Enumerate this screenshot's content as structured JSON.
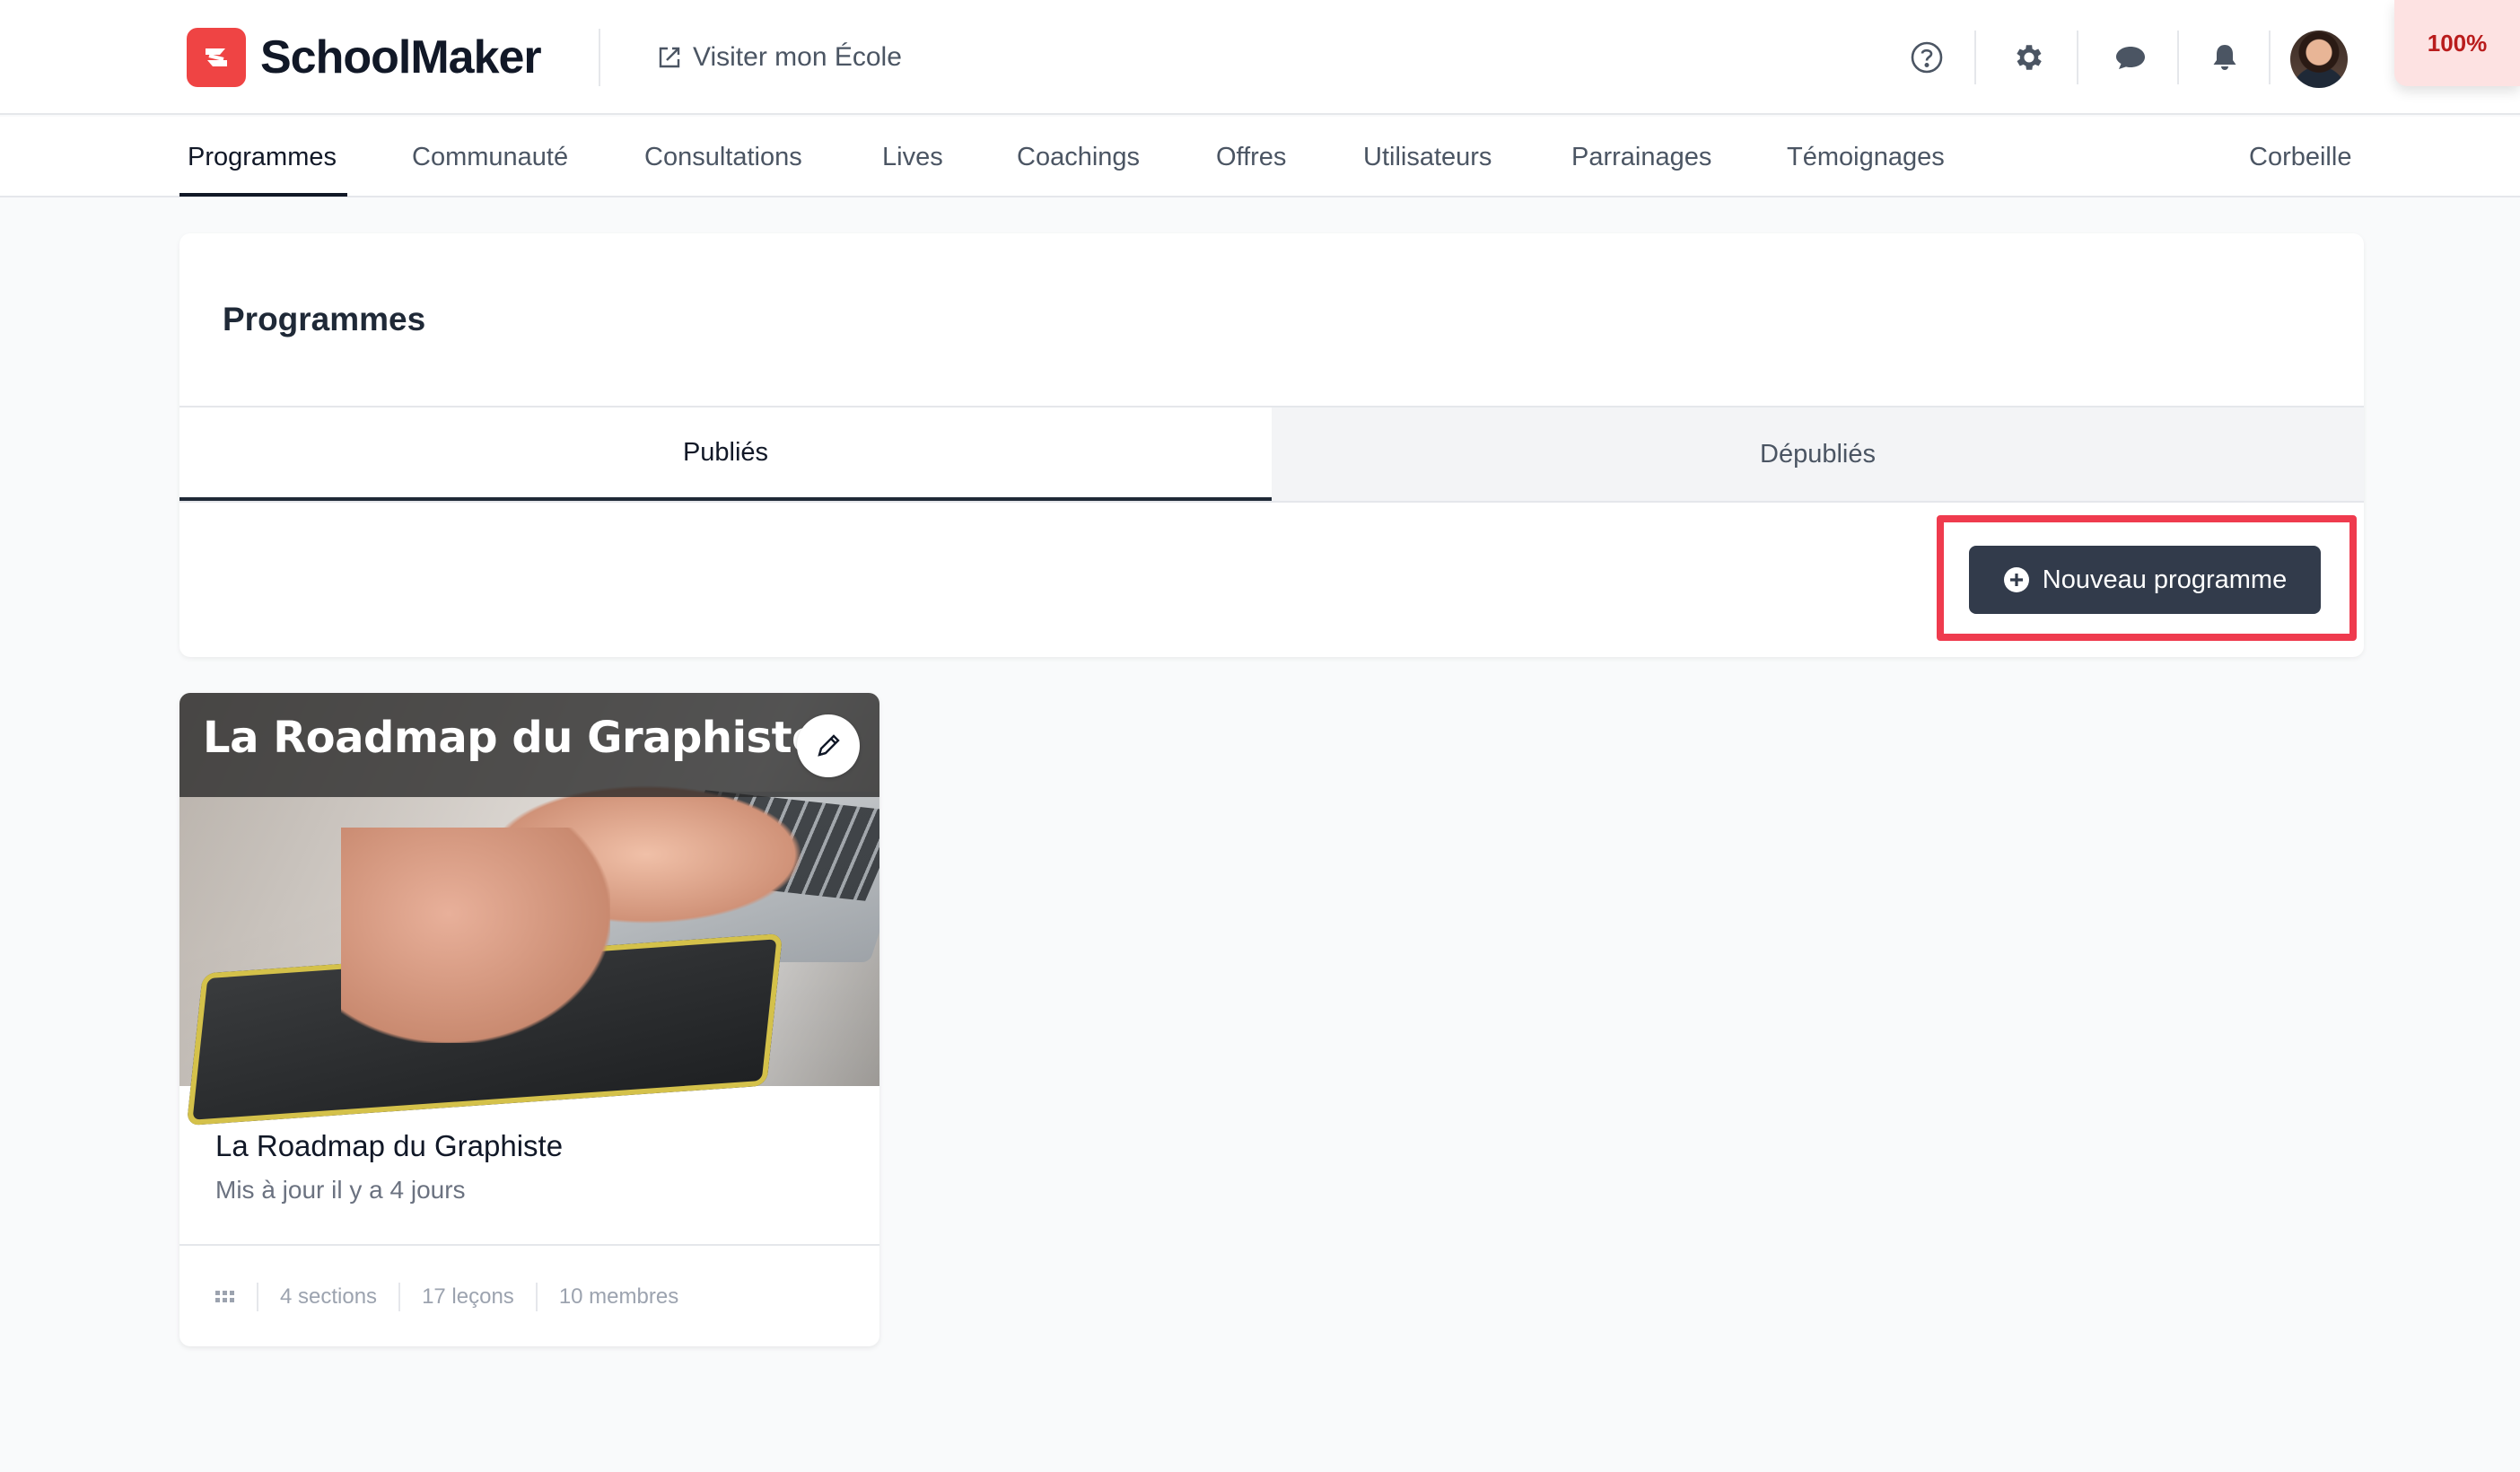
{
  "header": {
    "brand": "SchoolMaker",
    "visit_label": "Visiter mon École",
    "zoom": "100%",
    "icons": [
      "help-circle-icon",
      "gear-icon",
      "chat-bubble-icon",
      "bell-icon"
    ]
  },
  "nav": {
    "items": [
      {
        "label": "Programmes",
        "active": true
      },
      {
        "label": "Communauté"
      },
      {
        "label": "Consultations"
      },
      {
        "label": "Lives"
      },
      {
        "label": "Coachings"
      },
      {
        "label": "Offres"
      },
      {
        "label": "Utilisateurs"
      },
      {
        "label": "Parrainages"
      },
      {
        "label": "Témoignages"
      }
    ],
    "trash": "Corbeille"
  },
  "programs_panel": {
    "title": "Programmes",
    "tabs": {
      "published": "Publiés",
      "unpublished": "Dépubliés"
    },
    "new_button": "Nouveau programme"
  },
  "program_card": {
    "banner_title": "La Roadmap du Graphiste",
    "name": "La Roadmap du Graphiste",
    "updated": "Mis à jour il y a 4 jours",
    "sections": "4 sections",
    "lessons": "17 leçons",
    "members": "10 membres"
  },
  "colors": {
    "accent": "#ef4444",
    "primary_button": "#323b4b",
    "highlight": "#ef3b4e"
  }
}
